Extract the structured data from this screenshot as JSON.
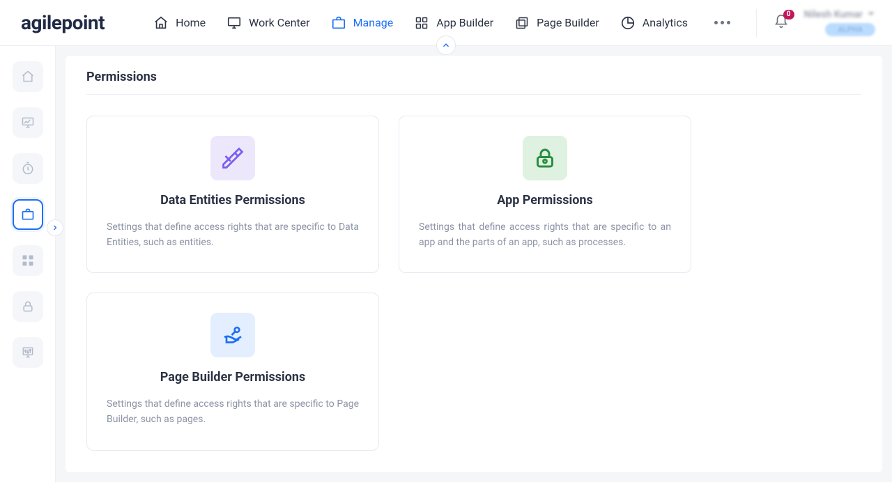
{
  "logo": "agilepoint",
  "nav": {
    "home": {
      "label": "Home"
    },
    "work_center": {
      "label": "Work Center"
    },
    "manage": {
      "label": "Manage"
    },
    "app_builder": {
      "label": "App Builder"
    },
    "page_builder": {
      "label": "Page Builder"
    },
    "analytics": {
      "label": "Analytics"
    }
  },
  "notifications": {
    "count": "0"
  },
  "user": {
    "name": "Nilesh Kumar",
    "env_label": "ALPHA"
  },
  "page": {
    "title": "Permissions"
  },
  "cards": {
    "data_entities": {
      "title": "Data Entities Permissions",
      "desc": "Settings that define access rights that are specific to Data Entities, such as entities."
    },
    "app": {
      "title": "App Permissions",
      "desc": "Settings that define access rights that are specific to an app and the parts of an app, such as processes."
    },
    "page_builder": {
      "title": "Page Builder Permissions",
      "desc": "Settings that define access rights that are specific to Page Builder, such as pages."
    }
  }
}
